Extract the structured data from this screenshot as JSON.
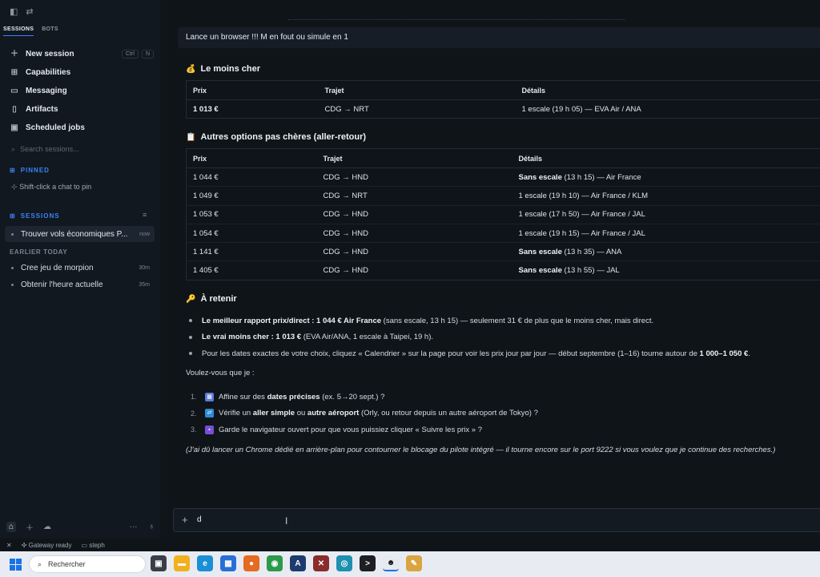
{
  "sidebar": {
    "tabs": [
      "SESSIONS",
      "BOTS"
    ],
    "nav": [
      {
        "label": "New session",
        "icon": "plus-icon"
      },
      {
        "label": "Capabilities",
        "icon": "grid-icon"
      },
      {
        "label": "Messaging",
        "icon": "chat-bubble-icon"
      },
      {
        "label": "Artifacts",
        "icon": "file-icon"
      },
      {
        "label": "Scheduled jobs",
        "icon": "calendar-icon"
      }
    ],
    "shortcut": [
      "Ctrl",
      "N"
    ],
    "search_placeholder": "Search sessions...",
    "pinned_header": "PINNED",
    "pin_hint": "Shift-click a chat to pin",
    "sessions_header": "SESSIONS",
    "active_session": {
      "title": "Trouver vols économiques P...",
      "time": "now"
    },
    "earlier_header": "EARLIER TODAY",
    "earlier": [
      {
        "title": "Cree jeu de morpion",
        "time": "30m"
      },
      {
        "title": "Obtenir l'heure actuelle",
        "time": "35m"
      }
    ]
  },
  "status": {
    "gateway": "Gateway ready",
    "profile": "steph"
  },
  "chat": {
    "user_message": "Lance un browser !!! M en fout ou simule en 1",
    "cheapest": {
      "heading": "Le moins cher",
      "emoji": "💰",
      "headers": [
        "Prix",
        "Trajet",
        "Détails"
      ],
      "rows": [
        [
          "1 013 €",
          "CDG → NRT",
          "1 escale (19 h 05) — EVA Air / ANA"
        ]
      ]
    },
    "others": {
      "heading": "Autres options pas chères (aller-retour)",
      "emoji": "📋",
      "headers": [
        "Prix",
        "Trajet",
        "Détails"
      ],
      "rows": [
        {
          "price": "1 044 €",
          "route": "CDG → HND",
          "bold": "Sans escale",
          "rest": " (13 h 15) — Air France"
        },
        {
          "price": "1 049 €",
          "route": "CDG → NRT",
          "bold": "",
          "rest": "1 escale (19 h 10) — Air France / KLM"
        },
        {
          "price": "1 053 €",
          "route": "CDG → HND",
          "bold": "",
          "rest": "1 escale (17 h 50) — Air France / JAL"
        },
        {
          "price": "1 054 €",
          "route": "CDG → HND",
          "bold": "",
          "rest": "1 escale (19 h 15) — Air France / JAL"
        },
        {
          "price": "1 141 €",
          "route": "CDG → HND",
          "bold": "Sans escale",
          "rest": " (13 h 35) — ANA"
        },
        {
          "price": "1 405 €",
          "route": "CDG → HND",
          "bold": "Sans escale",
          "rest": " (13 h 55) — JAL"
        }
      ]
    },
    "retain": {
      "heading": "À retenir",
      "emoji": "🔑",
      "b1_bold": "Le meilleur rapport prix/direct : 1 044 € Air France",
      "b1_rest": " (sans escale, 13 h 15) — seulement 31 € de plus que le moins cher, mais direct.",
      "b2_bold": "Le vrai moins cher : 1 013 €",
      "b2_rest": " (EVA Air/ANA, 1 escale à Taipei, 19 h).",
      "b3_text": "Pour les dates exactes de votre choix, cliquez « Calendrier » sur la page pour voir les prix jour par jour — début septembre (1–16) tourne autour de ",
      "b3_bold": "1 000–1 050 €",
      "b3_end": "."
    },
    "question": "Voulez-vous que je :",
    "options": [
      {
        "num": "1.",
        "a": "Affine sur des ",
        "b": "dates précises",
        "c": " (ex. 5→20 sept.) ?",
        "icon": "calendar-icon",
        "color": "#5b7bd5"
      },
      {
        "num": "2.",
        "a": "Vérifie un ",
        "b": "aller simple",
        "c": " ou ",
        "d": "autre aéroport",
        "e": " (Orly, ou retour depuis un autre aéroport de Tokyo) ?",
        "icon": "repeat-icon",
        "color": "#2f8ad8"
      },
      {
        "num": "3.",
        "a": "Garde le navigateur ouvert pour que vous puissiez cliquer « Suivre les prix » ?",
        "icon": "floppy-disk-icon",
        "color": "#7a4fd6"
      }
    ],
    "note": "(J'ai dû lancer un Chrome dédié en arrière-plan pour contourner le blocage du pilote intégré — il tourne encore sur le port 9222 si vous voulez que je continue des recherches.)"
  },
  "composer": {
    "value": "d"
  },
  "taskbar": {
    "search_label": "Rechercher"
  }
}
